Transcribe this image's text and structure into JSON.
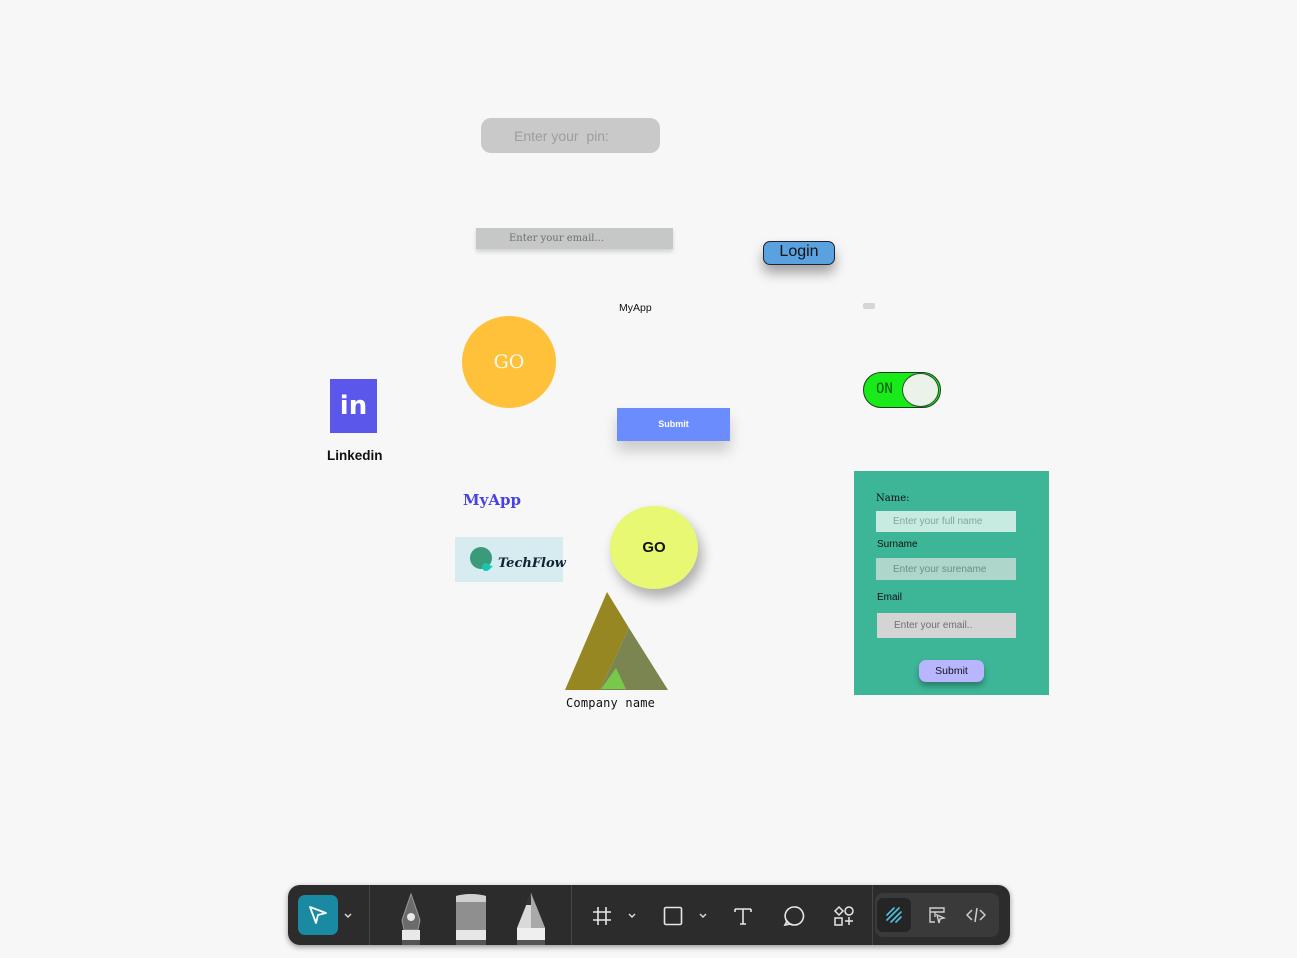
{
  "canvas": {
    "pin_input": {
      "placeholder": "Enter your  pin:"
    },
    "email_input": {
      "placeholder": "Enter your email..."
    },
    "login_button": {
      "label": "Login"
    },
    "myapp_small": "MyApp",
    "go_orange": {
      "label": "GO"
    },
    "linkedin": {
      "icon_text": "in",
      "label": "Linkedin"
    },
    "submit_blue": {
      "label": "Submit"
    },
    "toggle": {
      "state_label": "ON"
    },
    "myapp_blue": "MyApp",
    "techflow": {
      "label": "TechFlow"
    },
    "go_green": {
      "label": "GO"
    },
    "company_logo": {
      "label": "Company name"
    },
    "form": {
      "name_label": "Name:",
      "name_placeholder": "Enter your full name",
      "surname_label": "Surname",
      "surname_placeholder": "Enter your surename",
      "email_label": "Email",
      "email_placeholder": "Enter your email..",
      "submit_label": "Submit"
    }
  },
  "toolbar": {
    "tools": [
      "move-tool",
      "pen-tool",
      "brush-tool",
      "pencil-tool",
      "frame-tool",
      "rectangle-tool",
      "text-tool",
      "comment-tool",
      "assets-tool"
    ],
    "modes": [
      "draw-mode",
      "design-mode",
      "dev-mode"
    ],
    "active_tool": "move-tool",
    "active_mode": "draw-mode"
  },
  "colors": {
    "accent": "#1a8aa3",
    "toolbar_bg": "#2c2c2c",
    "canvas_bg": "#f7f7f7"
  }
}
